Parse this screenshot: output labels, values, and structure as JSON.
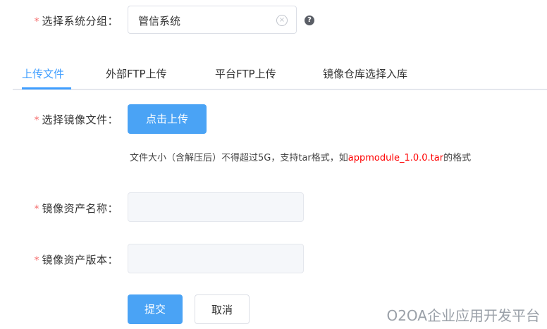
{
  "system_group": {
    "label": "选择系统分组：",
    "value": "管信系统",
    "clear_icon": "×",
    "help_icon": "?"
  },
  "tabs": [
    {
      "label": "上传文件",
      "active": true
    },
    {
      "label": "外部FTP上传",
      "active": false
    },
    {
      "label": "平台FTP上传",
      "active": false
    },
    {
      "label": "镜像仓库选择入库",
      "active": false
    }
  ],
  "upload": {
    "label": "选择镜像文件：",
    "button": "点击上传",
    "hint_prefix": "文件大小（含解压后）不得超过5G，支持tar格式，如",
    "hint_example": "appmodule_1.0.0.tar",
    "hint_suffix": "的格式"
  },
  "asset_name": {
    "label": "镜像资产名称：",
    "value": ""
  },
  "asset_version": {
    "label": "镜像资产版本：",
    "value": ""
  },
  "actions": {
    "submit": "提交",
    "cancel": "取消"
  },
  "required_mark": "*",
  "watermark": "O2OA企业应用开发平台",
  "colors": {
    "accent": "#409eff",
    "button": "#4aa3f5",
    "required": "#f56c6c",
    "example": "#ff0000"
  }
}
